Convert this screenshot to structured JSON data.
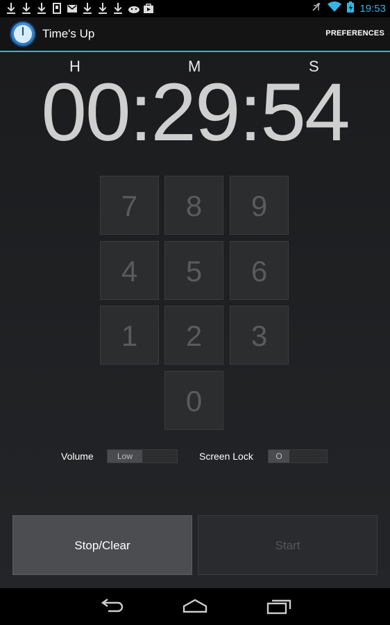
{
  "status_bar": {
    "notification_icons": [
      "download-icon",
      "download-icon",
      "download-icon",
      "sdcard-icon",
      "gmail-icon",
      "download-icon",
      "download-icon",
      "download-icon",
      "android-icon",
      "play-store-icon"
    ],
    "time": "19:53"
  },
  "action_bar": {
    "app_title": "Time's Up",
    "preferences_label": "PREFERENCES"
  },
  "timer": {
    "labels": {
      "h": "H",
      "m": "M",
      "s": "S"
    },
    "display": "00:29:54"
  },
  "keypad": {
    "keys": [
      "7",
      "8",
      "9",
      "4",
      "5",
      "6",
      "1",
      "2",
      "3",
      "0"
    ]
  },
  "options": {
    "volume_label": "Volume",
    "volume_value": "Low",
    "screen_lock_label": "Screen Lock",
    "screen_lock_value": "O"
  },
  "buttons": {
    "stop_label": "Stop/Clear",
    "start_label": "Start"
  },
  "colors": {
    "accent": "#33b5e5"
  }
}
